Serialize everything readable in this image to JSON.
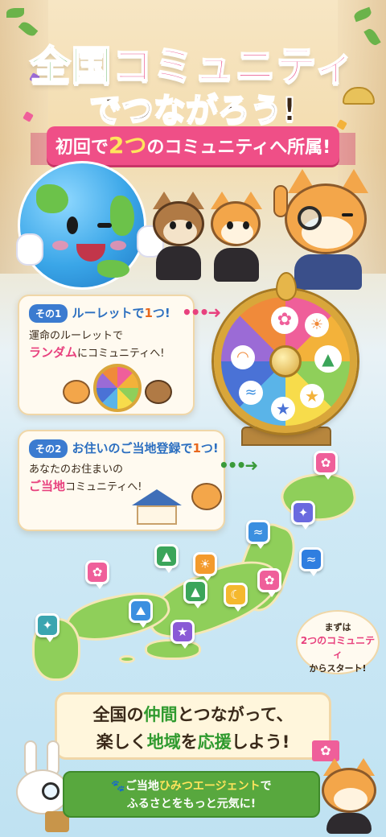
{
  "header": {
    "title_line1_part1": "全国",
    "title_line1_part2": "コミュニティ",
    "title_line2": "でつながろう!",
    "ribbon_before": "初回で",
    "ribbon_highlight": "2つ",
    "ribbon_after": "のコミュニティへ所属!"
  },
  "step1": {
    "tag": "その1",
    "heading_part1": "ルーレットで",
    "heading_highlight": "1",
    "heading_part2": "つ!",
    "body_line1": "運命のルーレットで",
    "body_pink": "ランダム",
    "body_line2_after": "にコミュニティへ!"
  },
  "step2": {
    "tag": "その2",
    "heading_part1": "お住いのご当地登録で",
    "heading_highlight": "1",
    "heading_part2": "つ!",
    "body_line1": "あなたのお住まいの",
    "body_pink": "ご当地",
    "body_line2_after": "コミュニティへ!"
  },
  "bubble": {
    "line1": "まずは",
    "line2": "2つのコミュニティ",
    "line3": "からスタート!"
  },
  "banner": {
    "line1_a": "全国の",
    "line1_hl": "仲間",
    "line1_b": "とつながって、",
    "line2_a": "楽しく",
    "line2_hl": "地域",
    "line2_b": "を",
    "line2_hl2": "応援",
    "line2_c": "しよう!"
  },
  "footer": {
    "paw": "🐾",
    "line1_a": "ご当地",
    "line1_hl": "ひみつエージェント",
    "line1_b": "で",
    "line2": "ふるさとをもっと元気に!"
  },
  "wheel_icons": [
    "flower-icon",
    "leaf-icon",
    "tree-icon",
    "star-icon",
    "star-icon",
    "wave-icon",
    "rainbow-icon",
    "sun-icon"
  ],
  "map_pins": [
    {
      "icon": "sakura-icon",
      "glyph": "✿",
      "color": "#ef5f9a"
    },
    {
      "icon": "star-icon",
      "glyph": "✦",
      "color": "#6a6adf"
    },
    {
      "icon": "wave-icon",
      "glyph": "≈",
      "color": "#3b8fe0"
    },
    {
      "icon": "wave-icon",
      "glyph": "≈",
      "color": "#2f7ee0"
    },
    {
      "icon": "tree-icon",
      "glyph": "▲",
      "color": "#3ba55a"
    },
    {
      "icon": "sun-icon",
      "glyph": "☀",
      "color": "#f39a2c"
    },
    {
      "icon": "sakura-icon",
      "glyph": "✿",
      "color": "#ef5f9a"
    },
    {
      "icon": "sakura-icon",
      "glyph": "✿",
      "color": "#ef5f9a"
    },
    {
      "icon": "tree-icon",
      "glyph": "▲",
      "color": "#3ba55a"
    },
    {
      "icon": "moon-icon",
      "glyph": "☾",
      "color": "#f5b82e"
    },
    {
      "icon": "mountain-icon",
      "glyph": "⛰",
      "color": "#3b8fe0"
    },
    {
      "icon": "star-icon",
      "glyph": "★",
      "color": "#8a5ad6"
    },
    {
      "icon": "star-icon",
      "glyph": "✦",
      "color": "#3ba5b0"
    }
  ],
  "colors": {
    "pink": "#e8417e",
    "green": "#2f9a2e",
    "blue": "#2c6fc0",
    "orange": "#e8671c"
  }
}
